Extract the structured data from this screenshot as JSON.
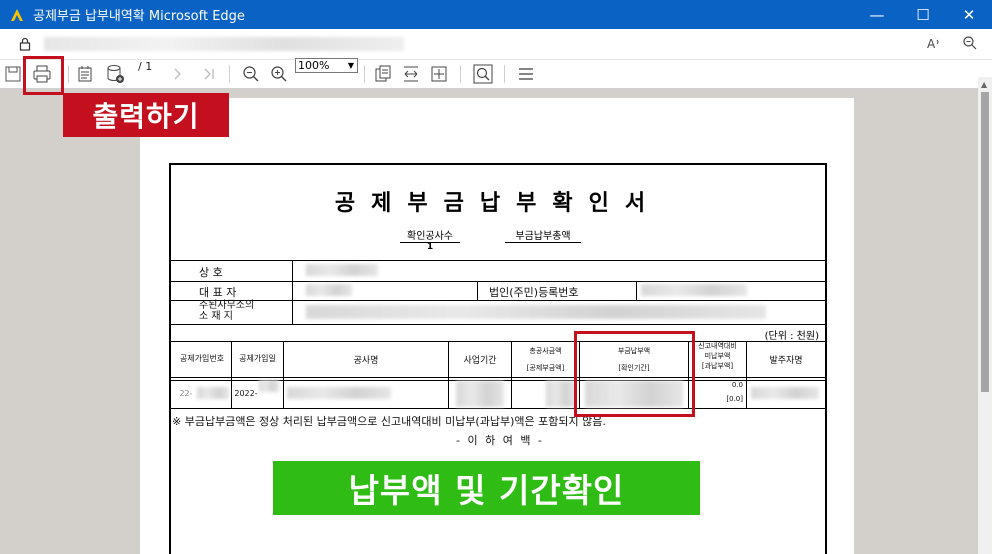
{
  "window": {
    "title": "공제부금 납부내역확 Microsoft Edge",
    "minimize": "—",
    "maximize": "☐",
    "close": "✕"
  },
  "toolbar": {
    "page_indicator": "/ 1",
    "zoom_value": "100%",
    "zoom_arrow": "▼",
    "print_annotation": "출력하기"
  },
  "document": {
    "title": "공제부금납부확인서",
    "summary": [
      {
        "label": "확인공사수",
        "value": "1"
      },
      {
        "label": "부금납부총액",
        "value": ""
      }
    ],
    "rows": {
      "company": "상          호",
      "representative": "대     표     자",
      "reg_no_label": "법인(주민)등록번호",
      "address_line1": "주된사무소의",
      "address_line2": "소     재     지"
    },
    "unit": "(단위 : 천원)",
    "table_headers": {
      "contract_no": "공제가입번호",
      "contract_date": "공제가입일",
      "project_name": "공사명",
      "period": "사업기간",
      "amount_top": "총공사금액",
      "amount_bottom": "[공제부금액]",
      "paid_top": "부금납부액",
      "paid_bottom": "[확인기간]",
      "diff_1": "신고내역대비",
      "diff_2": "미납부액",
      "diff_3": "[과납부액]",
      "client": "발주자명"
    },
    "table_row": {
      "contract_no": "22-",
      "contract_date": "2022-",
      "diff_top": "0.0",
      "diff_bottom": "[0.0]"
    },
    "note": "※ 부금납부금액은 정상 처리된 납부금액으로 신고내역대비 미납부(과납부)액은 포함되지 않음.",
    "end_text": "- 이 하 여 백 -",
    "banner": "납부액 및 기간확인"
  },
  "colors": {
    "titlebar": "#0a63c4",
    "highlight": "#c4101e",
    "banner": "#2fbc14"
  }
}
